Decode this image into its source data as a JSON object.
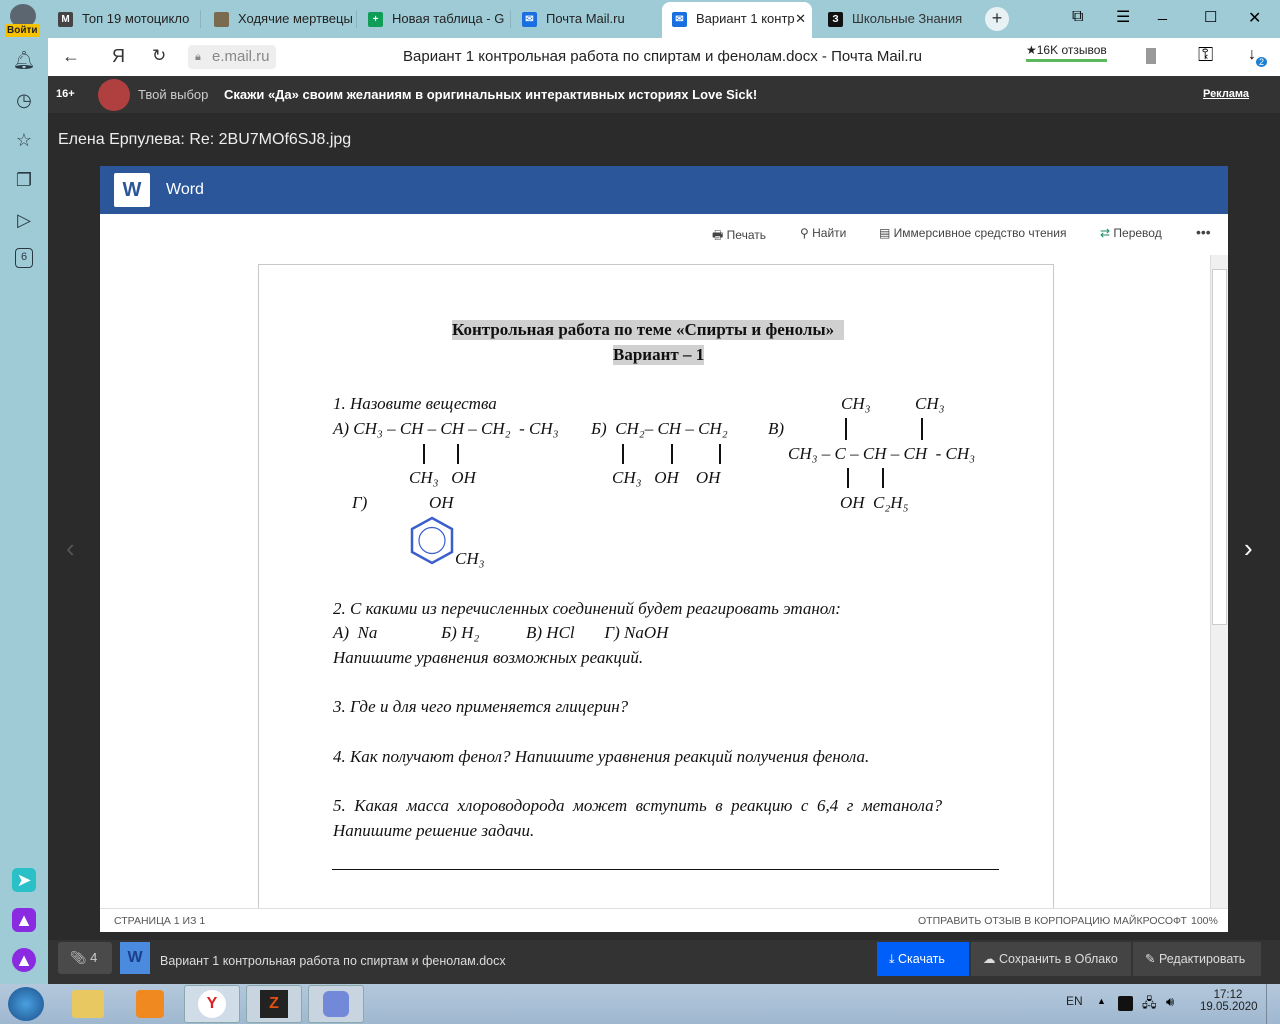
{
  "browser": {
    "login_label": "Войти",
    "tabs": [
      {
        "label": "Топ 19 мотоцикло",
        "icon": "moto-icon"
      },
      {
        "label": "Ходячие мертвецы",
        "icon": "movie-icon"
      },
      {
        "label": "Новая таблица - G",
        "icon": "sheets-icon"
      },
      {
        "label": "Почта Mail.ru",
        "icon": "mail-icon"
      },
      {
        "label": "Вариант 1 контр",
        "icon": "mail-icon",
        "active": true
      },
      {
        "label": "Школьные Знания",
        "icon": "znanija-icon"
      }
    ],
    "url": "e.mail.ru",
    "page_title": "Вариант 1 контрольная работа по спиртам и фенолам.docx - Почта Mail.ru",
    "reviews": "★16K отзывов",
    "downloads_badge": "2",
    "sidebar_badge": "6"
  },
  "ad": {
    "age": "16+",
    "source": "Твой выбор",
    "text": "Скажи «Да» своим желаниям в оригинальных интерактивных историях Love Sick!",
    "link": "Реклама"
  },
  "mail": {
    "subject": "Елена Ерпулева: Re: 2BU7MOf6SJ8.jpg"
  },
  "word": {
    "app": "Word",
    "toolbar": {
      "print": "Печать",
      "find": "Найти",
      "reader": "Иммерсивное средство чтения",
      "translate": "Перевод",
      "more": "•••"
    },
    "status": {
      "page": "СТРАНИЦА 1 ИЗ 1",
      "feedback": "ОТПРАВИТЬ ОТЗЫВ В КОРПОРАЦИЮ МАЙКРОСОФТ",
      "zoom": "100%"
    }
  },
  "doc": {
    "title": "Контрольная работа по теме «Спирты и фенолы»",
    "variant": "Вариант – 1",
    "q1": {
      "heading": "1. Назовите вещества",
      "a_main": "А) CH₃ – CH – CH – CH₂  - CH₃",
      "a_sub": "CH₃   OH",
      "b_main": "Б)  CH₂– CH – CH₂",
      "b_sub": "CH₃   OH    OH",
      "v_label": "В)",
      "v_top1": "CH₃",
      "v_top2": "CH₃",
      "v_main": "CH₃ – C – CH – CH  - CH₃",
      "v_sub": "OH  C₂H₅",
      "g_label": "Г)",
      "g_oh": "OH",
      "g_ch3": "CH₃"
    },
    "q2": {
      "text": "2. С какими из перечисленных соединений будет реагировать этанол:",
      "options": "А)  Na               Б) H₂           В) HCl       Г) NaOH",
      "note": "Напишите уравнения возможных реакций."
    },
    "q3": "3. Где и для чего применяется глицерин?",
    "q4": "4. Как получают фенол? Напишите уравнения реакций получения фенола.",
    "q5a": "5.  Какая  масса  хлороводорода  может  вступить  в  реакцию  с  6,4  г  метанола?",
    "q5b": "Напишите решение задачи."
  },
  "attachments": {
    "count": "4",
    "filename": "Вариант 1 контрольная работа по спиртам и фенолам.docx",
    "download": "Скачать",
    "save_cloud": "Сохранить в Облако",
    "edit": "Редактировать"
  },
  "taskbar": {
    "lang": "EN",
    "time": "17:12",
    "date": "19.05.2020"
  },
  "colors": {
    "word_blue": "#2b579a",
    "download_blue": "#005ff9",
    "browser_chrome": "#9fcbd6"
  }
}
